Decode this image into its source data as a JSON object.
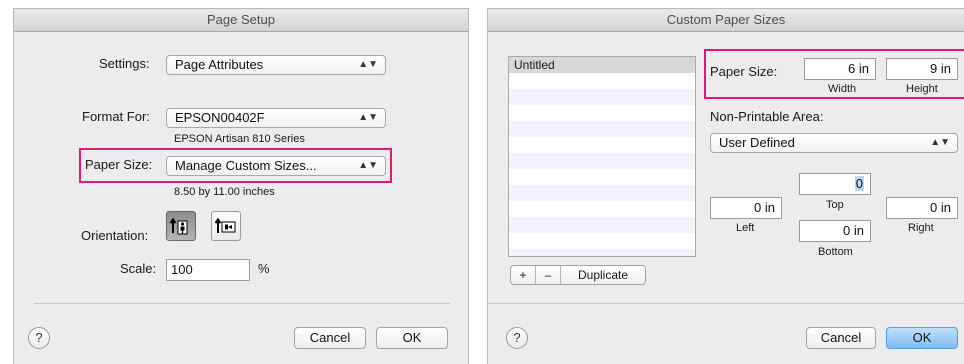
{
  "page_setup": {
    "title": "Page Setup",
    "settings_label": "Settings:",
    "settings_value": "Page Attributes",
    "format_for_label": "Format For:",
    "format_for_value": "EPSON00402F",
    "printer_model": "EPSON Artisan 810 Series",
    "paper_size_label": "Paper Size:",
    "paper_size_value": "Manage Custom Sizes...",
    "paper_dimensions": "8.50 by 11.00 inches",
    "orientation_label": "Orientation:",
    "orientation_selected": "portrait",
    "scale_label": "Scale:",
    "scale_value": "100",
    "scale_unit": "%",
    "help": "?",
    "cancel": "Cancel",
    "ok": "OK"
  },
  "custom_paper_sizes": {
    "title": "Custom Paper Sizes",
    "list_items": [
      "Untitled"
    ],
    "add": "+",
    "remove": "–",
    "duplicate": "Duplicate",
    "paper_size_label": "Paper Size:",
    "width_value": "6 in",
    "width_label": "Width",
    "height_value": "9 in",
    "height_label": "Height",
    "non_printable_label": "Non-Printable Area:",
    "non_printable_value": "User Defined",
    "top_value": "0",
    "top_label": "Top",
    "left_value": "0 in",
    "left_label": "Left",
    "right_value": "0 in",
    "right_label": "Right",
    "bottom_value": "0 in",
    "bottom_label": "Bottom",
    "help": "?",
    "cancel": "Cancel",
    "ok": "OK"
  },
  "colors": {
    "highlight": "#e0187a",
    "default_button": "#7fbcf5"
  }
}
